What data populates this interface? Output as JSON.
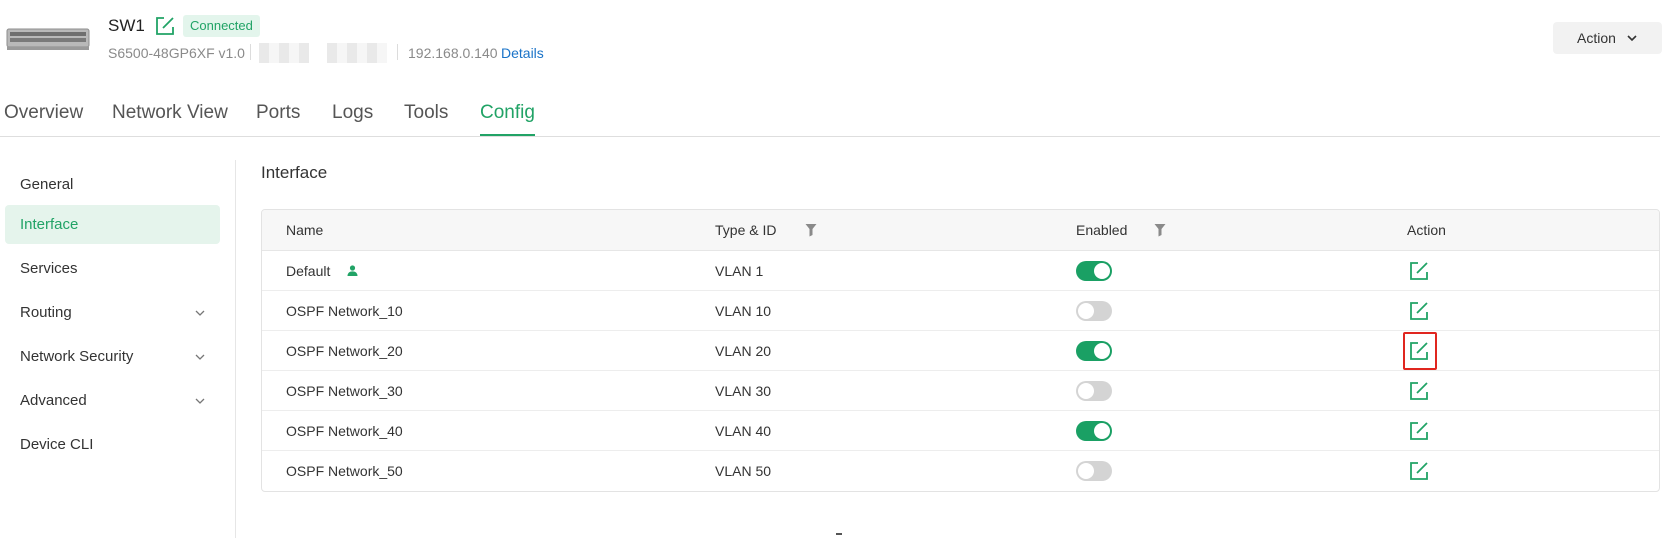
{
  "device": {
    "name": "SW1",
    "status": "Connected",
    "model": "S6500-48GP6XF v1.0",
    "ip": "192.168.0.140",
    "details_label": "Details",
    "action_label": "Action"
  },
  "tabs": [
    {
      "label": "Overview"
    },
    {
      "label": "Network View"
    },
    {
      "label": "Ports"
    },
    {
      "label": "Logs"
    },
    {
      "label": "Tools"
    },
    {
      "label": "Config",
      "active": true
    }
  ],
  "sidebar": {
    "items": [
      {
        "label": "General"
      },
      {
        "label": "Interface",
        "active": true
      },
      {
        "label": "Services"
      },
      {
        "label": "Routing",
        "expandable": true
      },
      {
        "label": "Network Security",
        "expandable": true
      },
      {
        "label": "Advanced",
        "expandable": true
      },
      {
        "label": "Device CLI"
      }
    ]
  },
  "content": {
    "title": "Interface",
    "columns": {
      "name": "Name",
      "type_id": "Type & ID",
      "enabled": "Enabled",
      "action": "Action"
    },
    "rows": [
      {
        "name": "Default",
        "type_id": "VLAN 1",
        "enabled": true,
        "default": true
      },
      {
        "name": "OSPF Network_10",
        "type_id": "VLAN 10",
        "enabled": false
      },
      {
        "name": "OSPF Network_20",
        "type_id": "VLAN 20",
        "enabled": true,
        "highlighted": true
      },
      {
        "name": "OSPF Network_30",
        "type_id": "VLAN 30",
        "enabled": false
      },
      {
        "name": "OSPF Network_40",
        "type_id": "VLAN 40",
        "enabled": true
      },
      {
        "name": "OSPF Network_50",
        "type_id": "VLAN 50",
        "enabled": false
      }
    ]
  },
  "colors": {
    "accent": "#21a366",
    "toggle_on": "#1aa064",
    "toggle_off": "#d4d4d4",
    "link": "#1a73c8",
    "highlight": "#e0261f"
  }
}
